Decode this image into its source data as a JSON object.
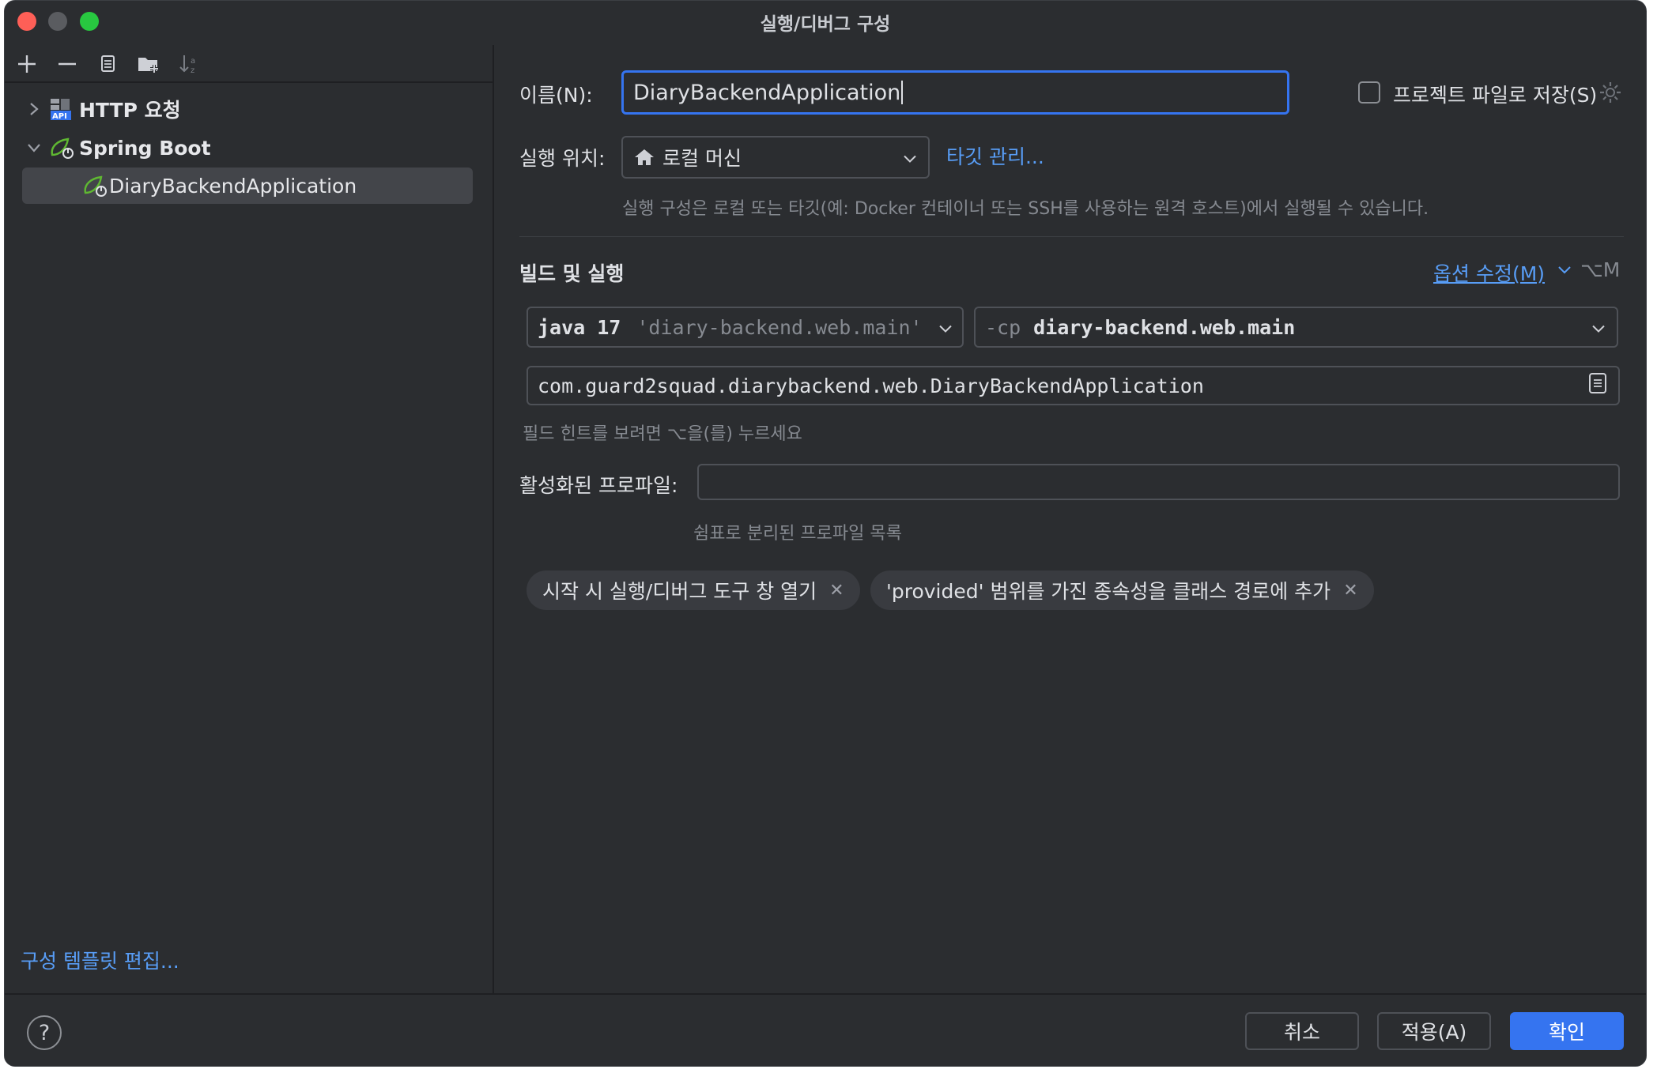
{
  "window": {
    "title": "실행/디버그 구성"
  },
  "tree": {
    "http_label": "HTTP 요청",
    "spring_label": "Spring Boot",
    "app_label": "DiaryBackendApplication"
  },
  "left_footer": {
    "edit_templates": "구성 템플릿 편집..."
  },
  "form": {
    "name_label": "이름(N):",
    "name_value": "DiaryBackendApplication",
    "store_label": "프로젝트 파일로 저장(S)",
    "run_on_label": "실행 위치:",
    "run_on_value": "로컬 머신",
    "manage_targets": "타깃 관리...",
    "run_on_hint": "실행 구성은 로컬 또는 타깃(예: Docker 컨테이너 또는 SSH를 사용하는 원격 호스트)에서 실행될 수 있습니다.",
    "section_title": "빌드 및 실행",
    "modify_options": "옵션 수정(M)",
    "modify_shortcut": "⌥M",
    "jdk_main": "java 17",
    "jdk_module": "'diary-backend.web.main'",
    "cp_flag": "-cp",
    "cp_value": "diary-backend.web.main",
    "main_class": "com.guard2squad.diarybackend.web.DiaryBackendApplication",
    "field_hint": "필드 힌트를 보려면 ⌥을(를) 누르세요",
    "profiles_label": "활성화된 프로파일:",
    "profiles_value": "",
    "profiles_hint": "쉼표로 분리된 프로파일 목록",
    "tags": [
      "시작 시 실행/디버그 도구 창 열기",
      "'provided' 범위를 가진 종속성을 클래스 경로에 추가"
    ]
  },
  "footer": {
    "help": "?",
    "cancel": "취소",
    "apply": "적용(A)",
    "ok": "확인"
  },
  "colors": {
    "accent": "#3574f0",
    "link": "#589df6",
    "background": "#2b2d30"
  }
}
